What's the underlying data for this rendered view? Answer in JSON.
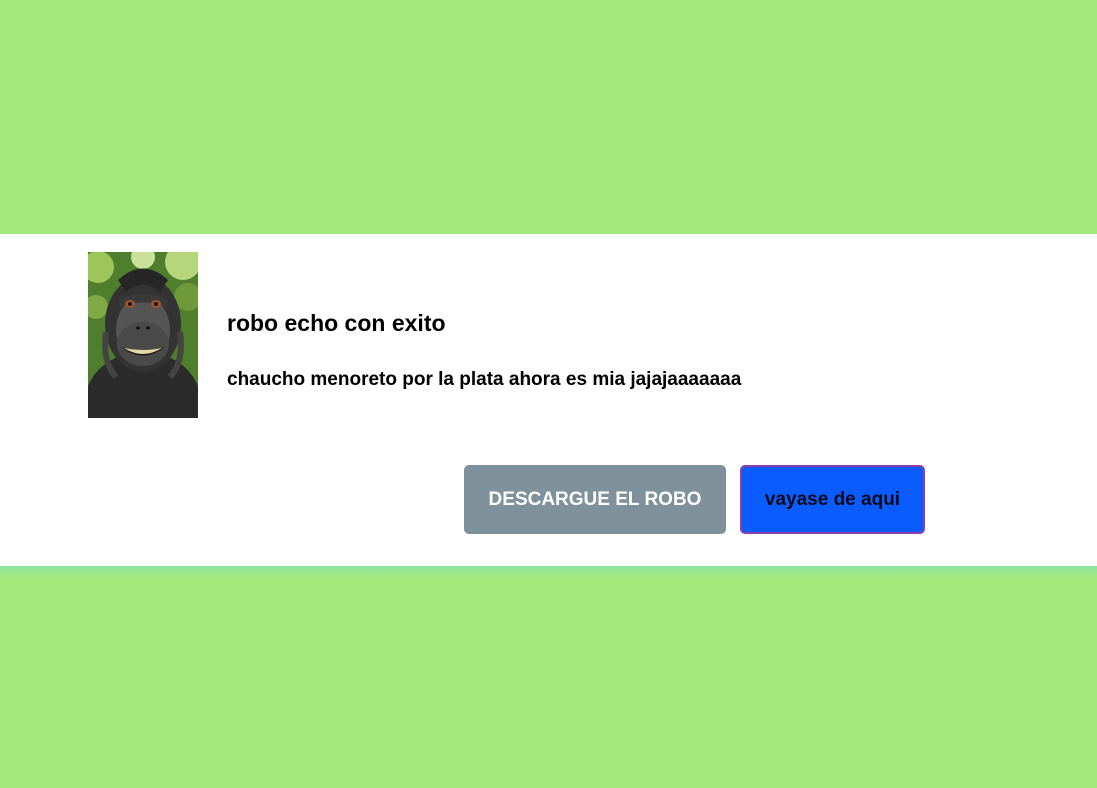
{
  "background_color": "#a1e97b",
  "dialog": {
    "image": {
      "icon": "monkey-selfie-photo"
    },
    "title": "robo echo con exito",
    "message": "chaucho menoreto por la plata ahora es mia jajajaaaaaaa",
    "buttons": {
      "download_label": "DESCARGUE EL ROBO",
      "download_color": "#7f929c",
      "leave_label": "vayase de aqui",
      "leave_color": "#0a5cff"
    }
  }
}
